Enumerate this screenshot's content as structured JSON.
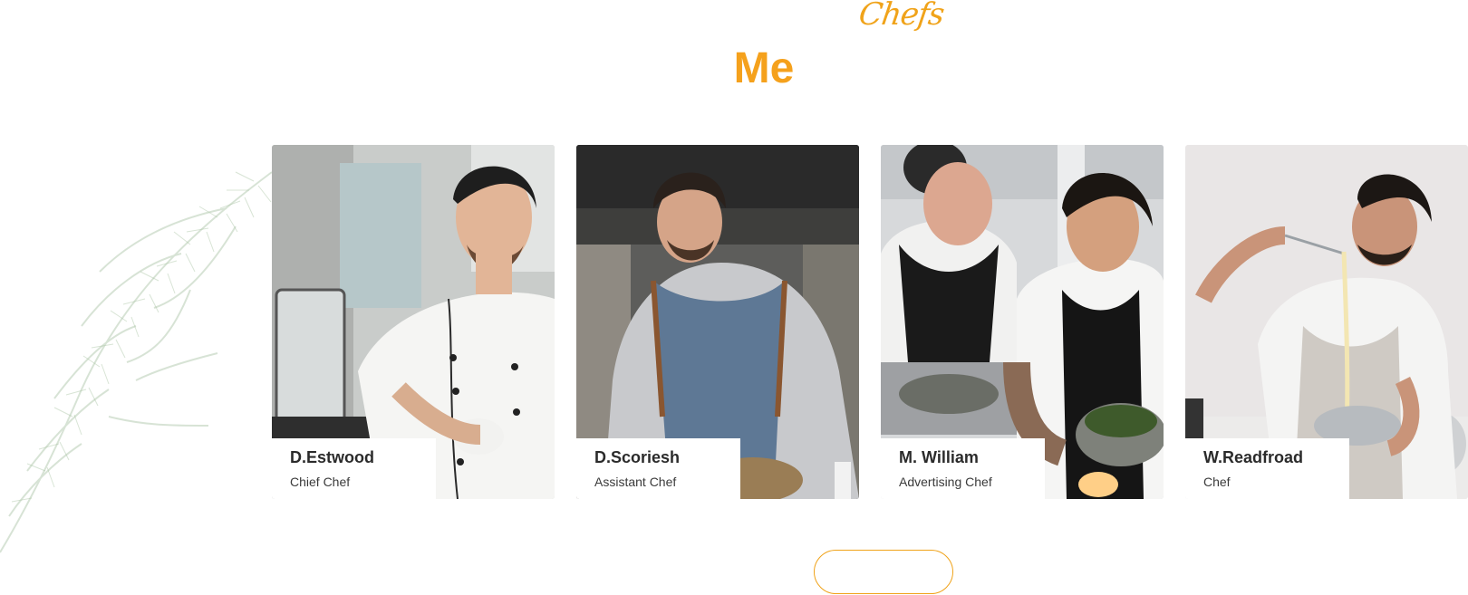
{
  "section": {
    "script_title": "Chefs",
    "title": "Me"
  },
  "chefs": [
    {
      "name": "D.Estwood",
      "role": "Chief Chef"
    },
    {
      "name": "D.Scoriesh",
      "role": "Assistant Chef"
    },
    {
      "name": "M. William",
      "role": "Advertising Chef"
    },
    {
      "name": "W.Readfroad",
      "role": "Chef"
    }
  ],
  "colors": {
    "accent": "#f0a31a",
    "text_dark": "#2b2b2b"
  }
}
